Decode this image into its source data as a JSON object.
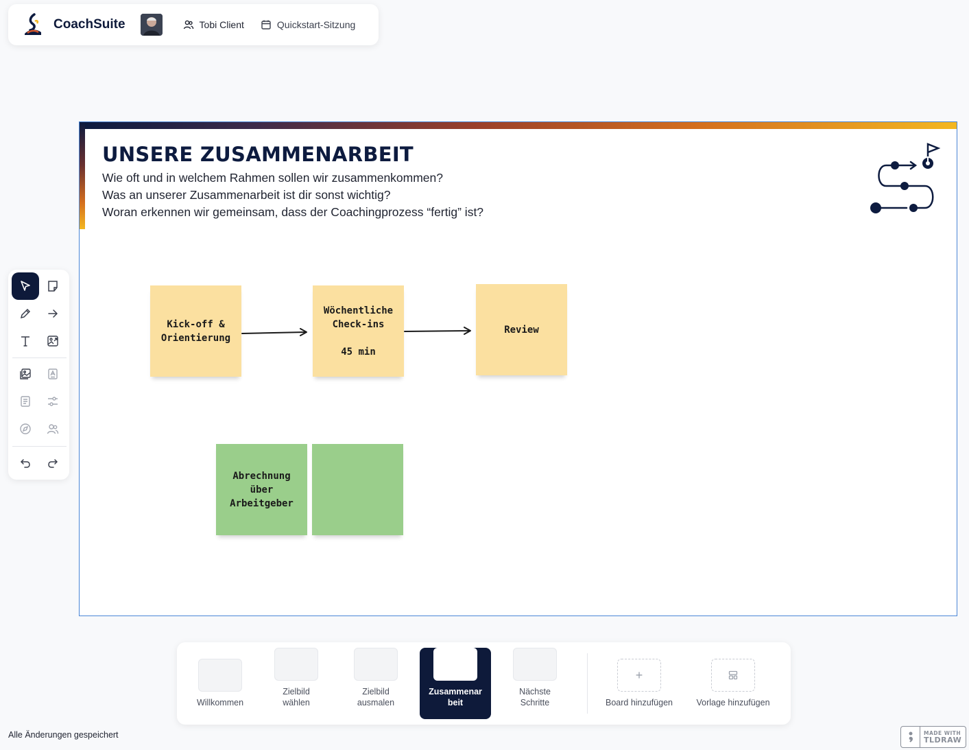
{
  "header": {
    "brand": "CoachSuite",
    "client_label": "Tobi Client",
    "session_label": "Quickstart-Sitzung"
  },
  "board": {
    "title": "UNSERE ZUSAMMENARBEIT",
    "questions": [
      "Wie oft und in welchem Rahmen sollen wir zusammenkommen?",
      "Was an unserer Zusammenarbeit ist dir sonst wichtig?",
      "Woran erkennen wir gemeinsam, dass der Coachingprozess “fertig” ist?"
    ],
    "stickies": [
      {
        "text": "Kick-off &\nOrientierung",
        "color": "#fbe0a0"
      },
      {
        "text": "Wöchentliche\nCheck-ins\n\n45 min",
        "color": "#fbe0a0"
      },
      {
        "text": "Review",
        "color": "#fbe0a0"
      },
      {
        "text": "Abrechnung\nüber\nArbeitgeber",
        "color": "#9ace8b"
      },
      {
        "text": "",
        "color": "#9ace8b"
      }
    ],
    "accent_color": "#0d1b3f"
  },
  "toolbar": {
    "tools": [
      "select-tool",
      "sticky-note-tool",
      "draw-tool",
      "arrow-tool",
      "text-tool",
      "image-tool",
      "gallery-tool",
      "template-tool",
      "list-tool",
      "settings-tool",
      "compass-tool",
      "people-tool",
      "undo",
      "redo"
    ]
  },
  "pages": [
    {
      "label": "Willkommen",
      "active": false
    },
    {
      "label": "Zielbild\nwählen",
      "active": false
    },
    {
      "label": "Zielbild\nausmalen",
      "active": false
    },
    {
      "label": "Zusammenar\nbeit",
      "active": true
    },
    {
      "label": "Nächste\nSchritte",
      "active": false
    }
  ],
  "page_actions": {
    "add_board": "Board hinzufügen",
    "add_template": "Vorlage hinzufügen"
  },
  "status": {
    "saved": "Alle Änderungen gespeichert"
  },
  "watermark": {
    "line1": "MADE WITH",
    "line2": "TLDRAW"
  }
}
